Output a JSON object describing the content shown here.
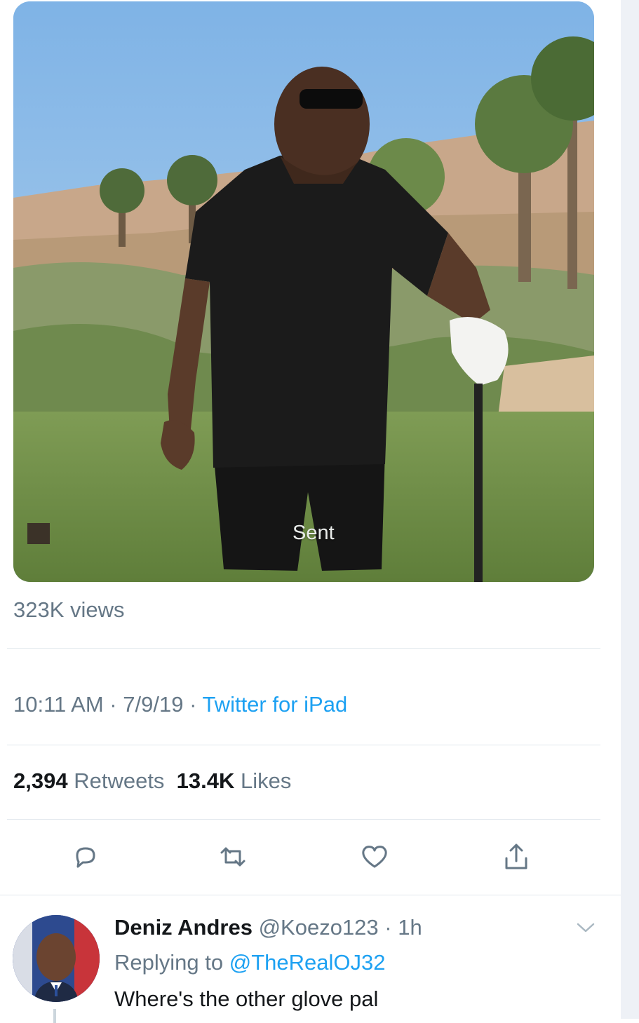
{
  "tweet": {
    "media": {
      "overlay_label": "Sent",
      "description_icon": "video-thumbnail"
    },
    "views": "323K views",
    "time": "10:11 AM",
    "date": "7/9/19",
    "source": "Twitter for iPad",
    "separator": " · ",
    "retweets_count": "2,394",
    "retweets_label": "Retweets",
    "likes_count": "13.4K",
    "likes_label": "Likes",
    "actions": [
      {
        "name": "reply",
        "icon": "reply-icon"
      },
      {
        "name": "retweet",
        "icon": "retweet-icon"
      },
      {
        "name": "like",
        "icon": "heart-icon"
      },
      {
        "name": "share",
        "icon": "share-icon"
      }
    ]
  },
  "reply": {
    "display_name": "Deniz Andres",
    "handle": "@Koezo123",
    "separator": " · ",
    "age": "1h",
    "replying_prefix": "Replying to ",
    "replying_to": "@TheRealOJ32",
    "text": "Where's the other glove pal"
  },
  "colors": {
    "accent": "#1da1f2",
    "secondary_text": "#657786",
    "primary_text": "#14171a",
    "divider": "#e1e8ed"
  }
}
